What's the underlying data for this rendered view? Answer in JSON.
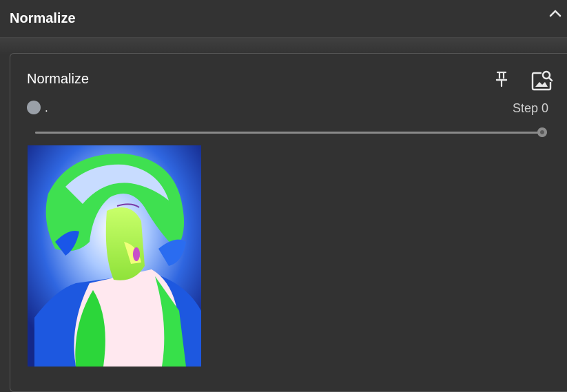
{
  "header": {
    "title": "Normalize",
    "collapse_icon": "chevron-up-icon"
  },
  "panel": {
    "title": "Normalize",
    "pin_icon": "pin-icon",
    "image_search_icon": "image-search-icon",
    "status_text": ".",
    "step_label": "Step 0",
    "slider": {
      "value_fraction": 1.0
    },
    "preview": {
      "kind": "normalized image preview"
    }
  },
  "colors": {
    "background": "#333333",
    "panel_border": "#555555",
    "status_dot": "#9aa0a8",
    "text": "#ffffff",
    "muted_text": "#cfcfcf"
  }
}
